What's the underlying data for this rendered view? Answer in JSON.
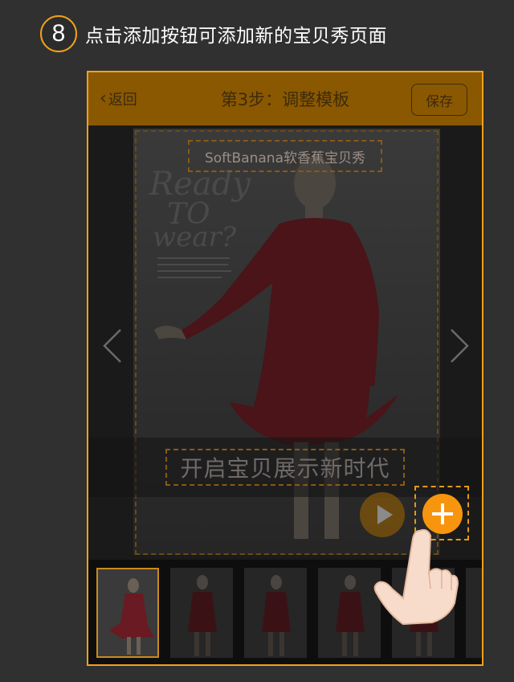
{
  "step": {
    "number": "8",
    "text": "点击添加按钮可添加新的宝贝秀页面"
  },
  "topbar": {
    "back_label": "返回",
    "title": "第3步：调整模板",
    "save_label": "保存"
  },
  "canvas": {
    "brand_text": "SoftBanana软香蕉宝贝秀",
    "magazine_text": [
      "Ready",
      "TO",
      "wear?"
    ],
    "slogan_text": "开启宝贝展示新时代"
  },
  "thumbnails": {
    "count": 6,
    "active_index": 0
  },
  "colors": {
    "accent": "#f5a01a",
    "topbar_dim": "#8a5800",
    "add_button": "#f7950e",
    "background": "#303030"
  }
}
